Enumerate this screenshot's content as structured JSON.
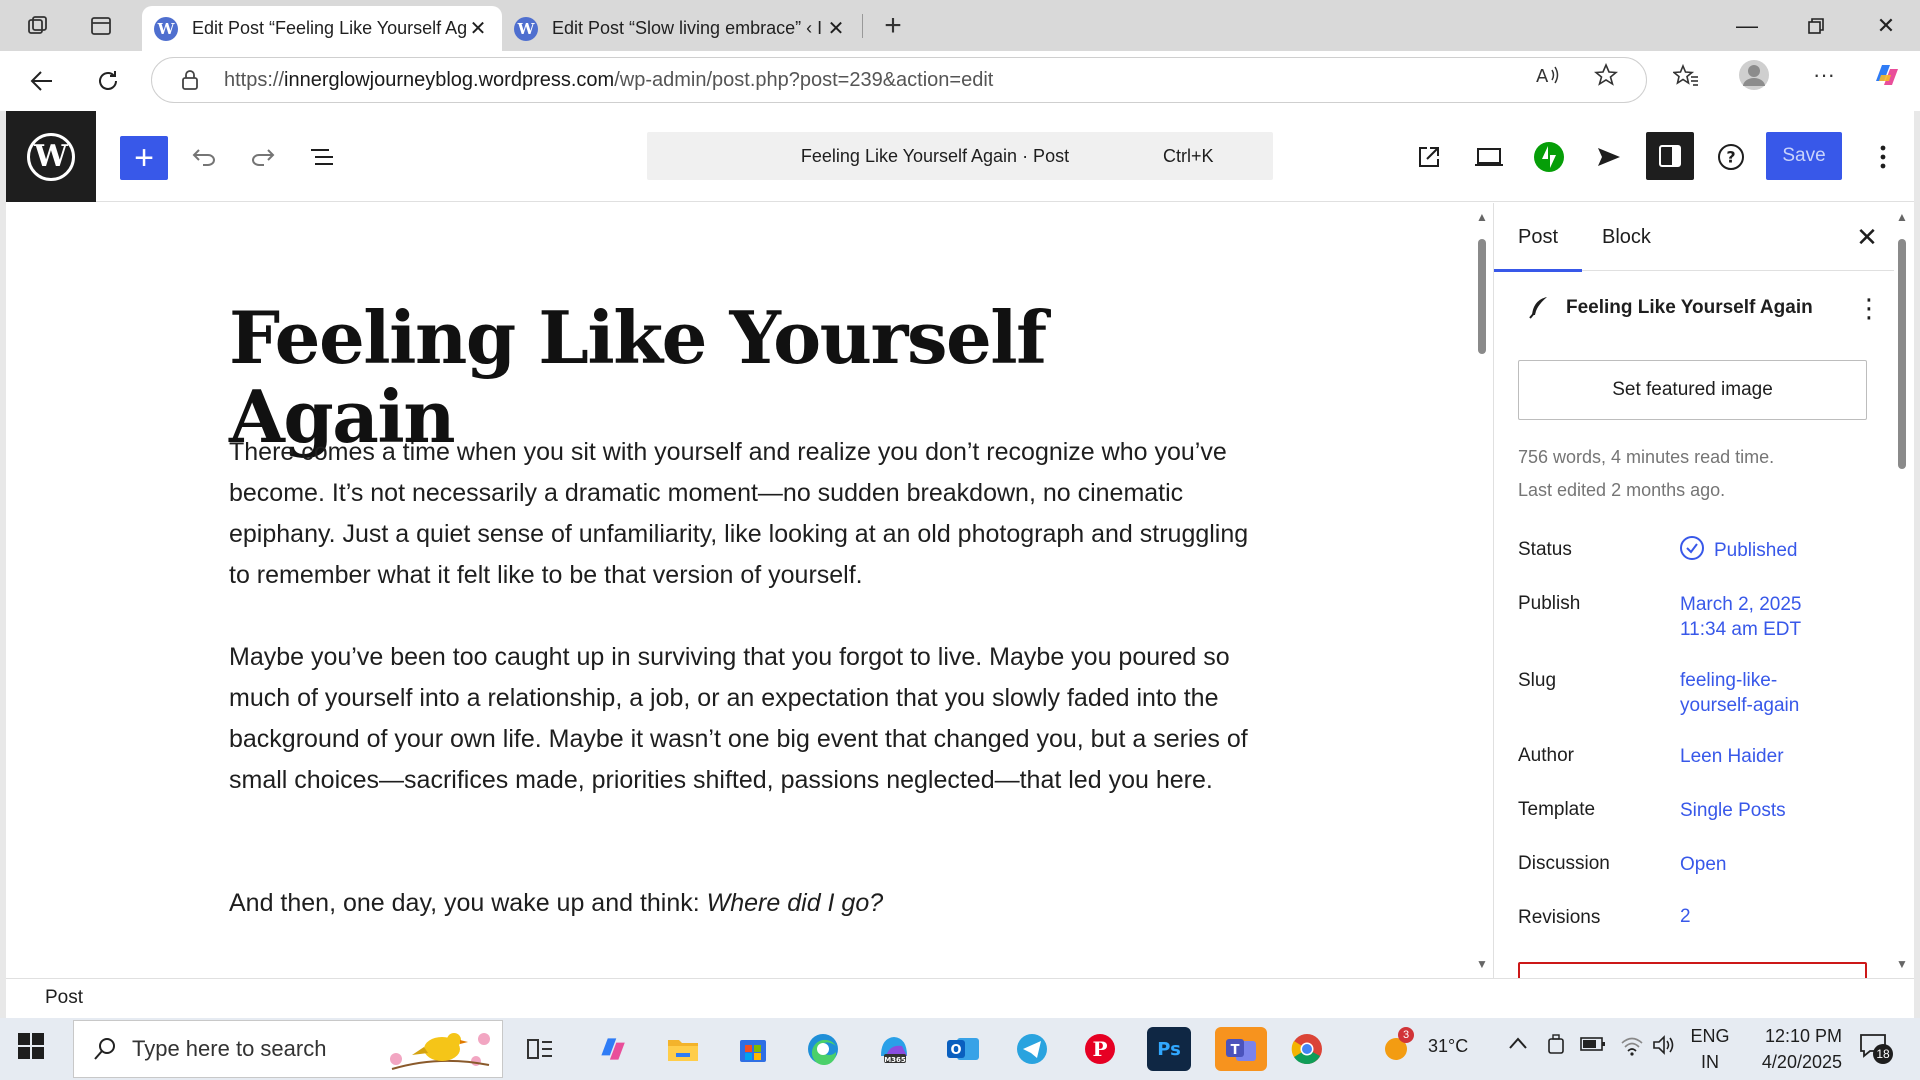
{
  "browser": {
    "tabs": [
      {
        "title": "Edit Post “Feeling Like Yourself Ag",
        "active": true
      },
      {
        "title": "Edit Post “Slow living embrace” ‹ I",
        "active": false
      }
    ],
    "url_host": "innerglowjourneyblog.wordpress.com",
    "url_prefix": "https://",
    "url_path": "/wp-admin/post.php?post=239&action=edit"
  },
  "editor": {
    "command_title": "Feeling Like Yourself Again · Post",
    "command_shortcut": "Ctrl+K",
    "save_label": "Save",
    "accent": "#3858e9"
  },
  "post": {
    "title": "Feeling Like Yourself Again",
    "paragraphs": [
      "There comes a time when you sit with yourself and realize you don’t recognize who you’ve become. It’s not necessarily a dramatic moment—no sudden breakdown, no cinematic epiphany. Just a quiet sense of unfamiliarity, like looking at an old photograph and struggling to remember what it felt like to be that version of yourself.",
      "Maybe you’ve been too caught up in surviving that you forgot to live. Maybe you poured so much of yourself into a relationship, a job, or an expectation that you slowly faded into the background of your own life. Maybe it wasn’t one big event that changed you, but a series of small choices—sacrifices made, priorities shifted, passions neglected—that led you here."
    ],
    "para3_lead": "And then, one day, you wake up and think: ",
    "para3_italic": "Where did I go?"
  },
  "sidebar": {
    "tab_post": "Post",
    "tab_block": "Block",
    "post_name": "Feeling Like Yourself Again",
    "featured_button": "Set featured image",
    "word_count": "756 words, 4 minutes read time.",
    "last_edited": "Last edited 2 months ago.",
    "rows": {
      "status_label": "Status",
      "status_value": "Published",
      "publish_label": "Publish",
      "publish_value_1": "March 2, 2025",
      "publish_value_2": "11:34 am EDT",
      "slug_label": "Slug",
      "slug_value_1": "feeling-like-",
      "slug_value_2": "yourself-again",
      "author_label": "Author",
      "author_value": "Leen Haider",
      "template_label": "Template",
      "template_value": "Single Posts",
      "discussion_label": "Discussion",
      "discussion_value": "Open",
      "revisions_label": "Revisions",
      "revisions_value": "2"
    }
  },
  "footer": {
    "breadcrumb": "Post"
  },
  "taskbar": {
    "search_placeholder": "Type here to search",
    "weather": "31°C",
    "weather_badge": "3",
    "lang_1": "ENG",
    "lang_2": "IN",
    "time": "12:10 PM",
    "date": "4/20/2025",
    "notification_count": "18"
  }
}
